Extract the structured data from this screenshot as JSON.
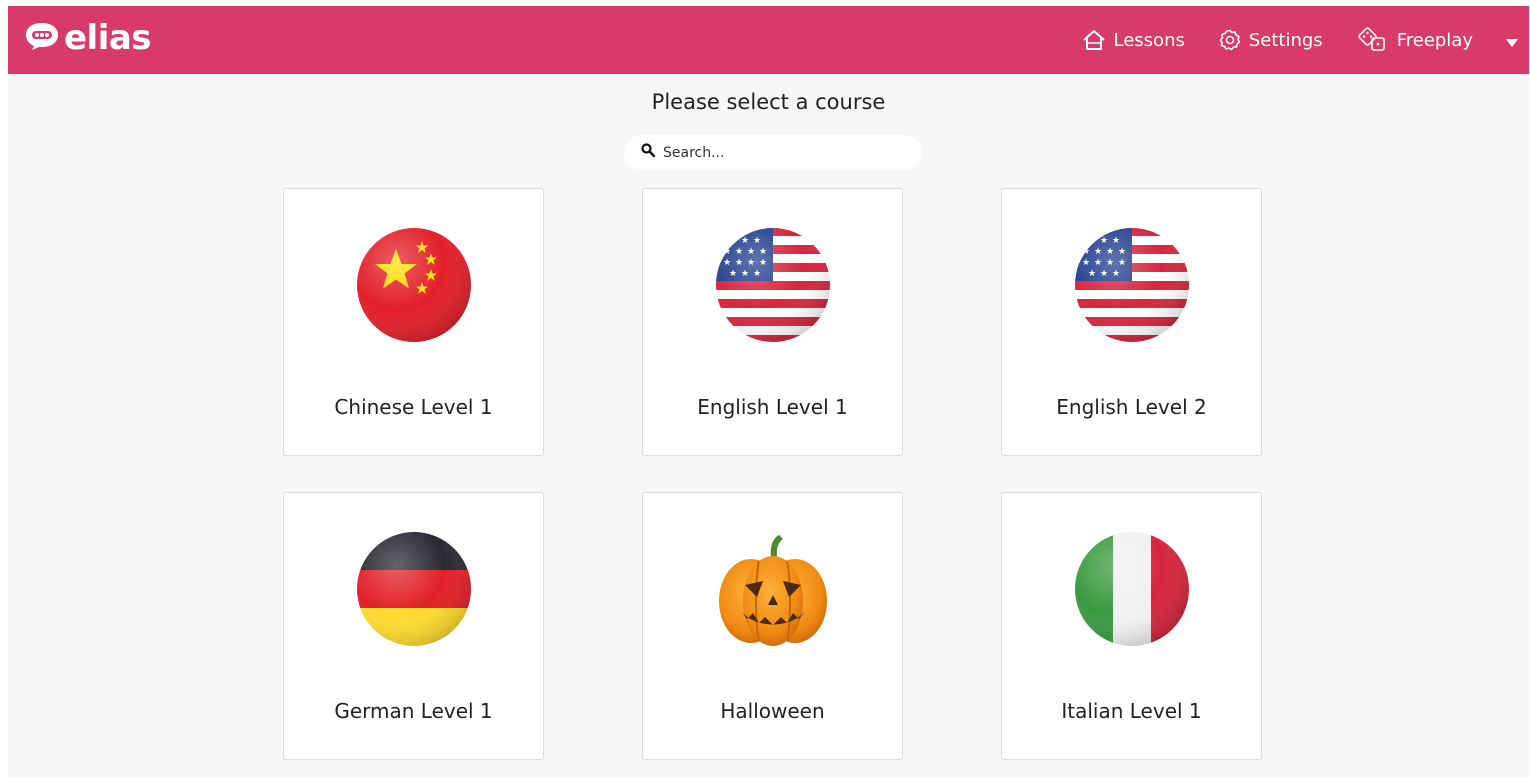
{
  "app": {
    "logo_text": "elias",
    "colors": {
      "brand": "#d83a6a",
      "background": "#f7f7f7",
      "card": "#ffffff",
      "text": "#222222"
    }
  },
  "nav": {
    "lessons": {
      "label": "Lessons",
      "icon": "home-icon"
    },
    "settings": {
      "label": "Settings",
      "icon": "gear-icon"
    },
    "freeplay": {
      "label": "Freeplay",
      "icon": "dice-icon"
    },
    "menu_icon": "caret-down-icon"
  },
  "main": {
    "title": "Please select a course",
    "search": {
      "placeholder": "Search...",
      "value": "",
      "icon": "search-icon"
    }
  },
  "courses": [
    {
      "label": "Chinese Level 1",
      "icon": "china-flag-icon"
    },
    {
      "label": "English Level 1",
      "icon": "usa-flag-icon"
    },
    {
      "label": "English Level 2",
      "icon": "usa-flag-icon"
    },
    {
      "label": "German Level 1",
      "icon": "germany-flag-icon"
    },
    {
      "label": "Halloween",
      "icon": "pumpkin-icon"
    },
    {
      "label": "Italian Level 1",
      "icon": "italy-flag-icon"
    }
  ]
}
